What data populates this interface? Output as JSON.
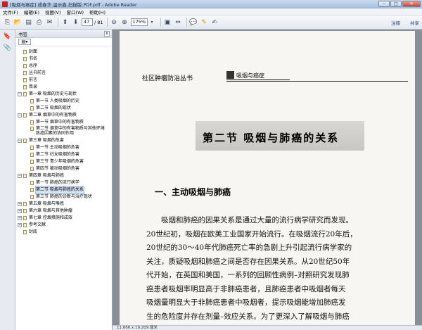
{
  "window": {
    "title": "[吸烟与癌症].成春华.温示鑫.扫描版.PDF.pdf - Adobe Reader",
    "controls": [
      "–",
      "□",
      "✕"
    ]
  },
  "menu": [
    "文件(F)",
    "编辑(E)",
    "视图(V)",
    "窗口(W)",
    "帮助(H)"
  ],
  "toolbar": {
    "page_current": "47",
    "page_total": "/ 81",
    "zoom": "175%",
    "right_buttons": [
      "注释",
      "共享"
    ]
  },
  "bookmarks": {
    "header": "书签",
    "close_icon": "x",
    "items": [
      {
        "level": 0,
        "toggle": "",
        "label": "封面"
      },
      {
        "level": 0,
        "toggle": "",
        "label": "书名"
      },
      {
        "level": 0,
        "toggle": "",
        "label": "总序"
      },
      {
        "level": 0,
        "toggle": "",
        "label": "丛书前言"
      },
      {
        "level": 0,
        "toggle": "",
        "label": "前言"
      },
      {
        "level": 0,
        "toggle": "",
        "label": "目录"
      },
      {
        "level": 0,
        "toggle": "−",
        "label": "第一章  吸烟的历史与现状"
      },
      {
        "level": 1,
        "toggle": "",
        "label": "第一节  人类吸烟的历史"
      },
      {
        "level": 1,
        "toggle": "",
        "label": "第二节  吸烟的现状"
      },
      {
        "level": 0,
        "toggle": "−",
        "label": "第二章  烟草中的有害物质"
      },
      {
        "level": 1,
        "toggle": "",
        "label": "第一节  烟草中的有害物质"
      },
      {
        "level": 1,
        "toggle": "",
        "label": "第二节  烟草中的有害物质与其他环境致癌因素的协同作用",
        "wrap": true
      },
      {
        "level": 0,
        "toggle": "−",
        "label": "第三章  吸烟的危害"
      },
      {
        "level": 1,
        "toggle": "",
        "label": "第一节  主动吸烟的危害"
      },
      {
        "level": 1,
        "toggle": "",
        "label": "第二节  妇女吸烟的危害"
      },
      {
        "level": 1,
        "toggle": "",
        "label": "第三节  青少年吸烟的危害"
      },
      {
        "level": 1,
        "toggle": "",
        "label": "第四节  被动吸烟的危害"
      },
      {
        "level": 0,
        "toggle": "−",
        "label": "第四章  吸烟与肺癌"
      },
      {
        "level": 1,
        "toggle": "",
        "label": "第一节  肺癌的流行病学"
      },
      {
        "level": 1,
        "toggle": "",
        "label": "第二节  吸烟与肺癌的关系",
        "selected": true
      },
      {
        "level": 1,
        "toggle": "",
        "label": "第三节  肺癌的诊断与治疗现状"
      },
      {
        "level": 0,
        "toggle": "+",
        "label": "第五章  吸烟与喉癌"
      },
      {
        "level": 0,
        "toggle": "+",
        "label": "第六章  吸烟与其他肿瘤"
      },
      {
        "level": 0,
        "toggle": "+",
        "label": "第七章  控烟措施和成效"
      },
      {
        "level": 0,
        "toggle": "+",
        "label": "参考文献"
      },
      {
        "level": 0,
        "toggle": "",
        "label": "封底"
      }
    ]
  },
  "document": {
    "running_header": "社区肿瘤防治丛书",
    "header_tab": "吸烟与癌症",
    "section_title": "第二节   吸烟与肺癌的关系",
    "heading": "一、主动吸烟与肺癌",
    "paragraph_lines": [
      "吸烟和肺癌的因果关系是通过大量的流行病学研究而发现。",
      "20世纪初，吸烟在欧美工业国家开始流行。在吸烟流行20年后，",
      "20世纪的30～40年代肺癌死亡率的急剧上升引起流行病学家的",
      "关注，质疑吸烟和肺癌之间是否存在因果关系。从20世纪50年",
      "代开始，在英国和美国，一系列的回顾性病例–对照研究发现肺",
      "癌患者吸烟率明显高于非肺癌患者，且肺癌患者中吸烟者每天",
      "吸烟量明显大于非肺癌患者中吸烟者，提示吸烟能增加肺癌发",
      "生的危险度并存在剂量–效应关系。为了更深入了解吸烟与肺癌"
    ],
    "page_size": "11.666 x 19.209 厘米"
  }
}
